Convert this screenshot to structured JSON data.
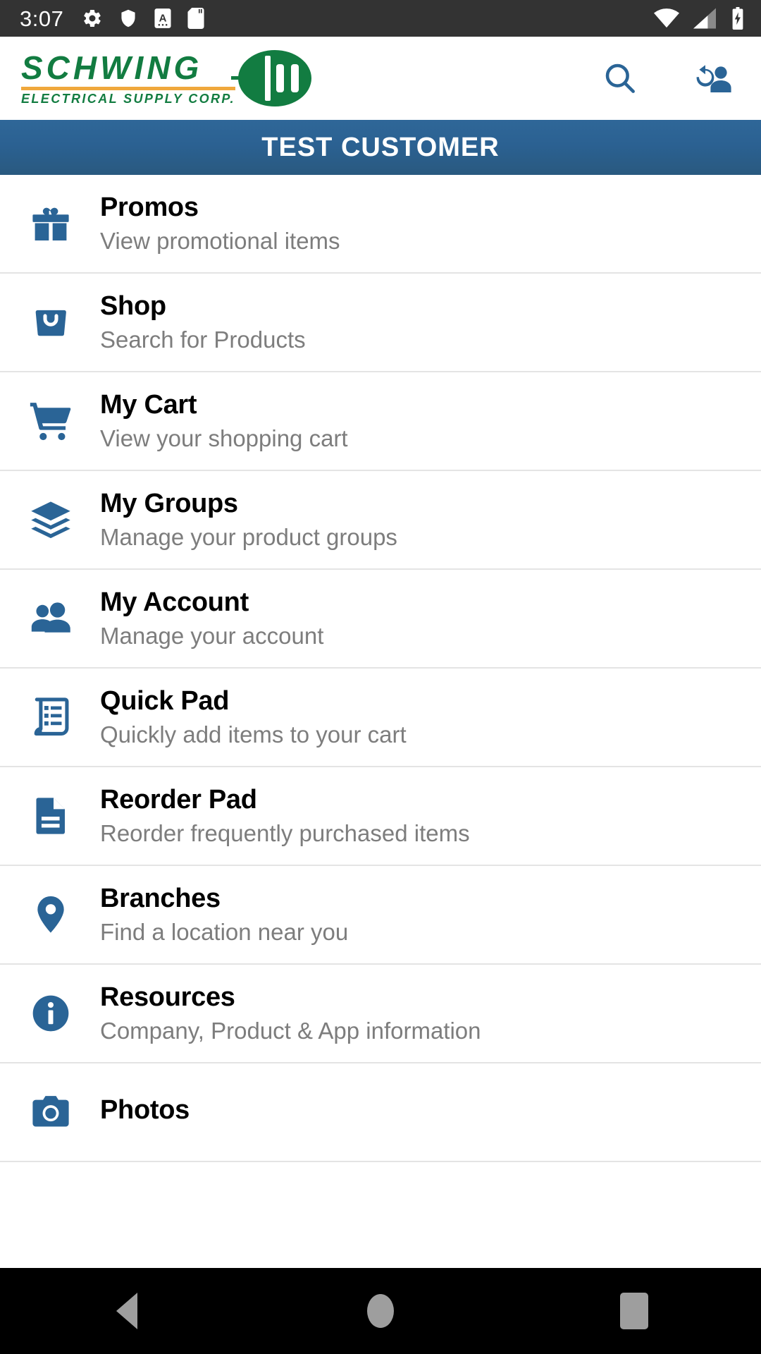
{
  "statusbar": {
    "time": "3:07",
    "left_icons": [
      "gear-icon",
      "shield-icon",
      "a-badge-icon",
      "sd-card-icon"
    ],
    "right_icons": [
      "wifi-icon",
      "cellular-signal-icon",
      "battery-charging-icon"
    ],
    "background_color": "#333333"
  },
  "header": {
    "logo_primary": "SCHWING",
    "logo_secondary": "ELECTRICAL SUPPLY CORP.",
    "logo_green": "#127c41",
    "logo_accent": "#f0a83c",
    "actions": [
      {
        "name": "search-button",
        "icon": "search-icon"
      },
      {
        "name": "switch-user-button",
        "icon": "switch-user-icon"
      }
    ],
    "action_color": "#2a6496"
  },
  "customer_banner": {
    "label": "TEST CUSTOMER",
    "background_color": "#2b6192",
    "text_color": "#ffffff"
  },
  "menu": {
    "icon_color": "#2a6496",
    "items": [
      {
        "icon": "gift-icon",
        "title": "Promos",
        "subtitle": "View promotional items"
      },
      {
        "icon": "shopping-bag-icon",
        "title": "Shop",
        "subtitle": "Search for Products"
      },
      {
        "icon": "shopping-cart-icon",
        "title": "My Cart",
        "subtitle": "View your shopping cart"
      },
      {
        "icon": "layers-icon",
        "title": "My Groups",
        "subtitle": "Manage your product groups"
      },
      {
        "icon": "people-icon",
        "title": "My Account",
        "subtitle": "Manage your account"
      },
      {
        "icon": "receipt-list-icon",
        "title": "Quick Pad",
        "subtitle": "Quickly add items to your cart"
      },
      {
        "icon": "document-icon",
        "title": "Reorder Pad",
        "subtitle": "Reorder frequently purchased items"
      },
      {
        "icon": "map-pin-icon",
        "title": "Branches",
        "subtitle": "Find a location near you"
      },
      {
        "icon": "info-circle-icon",
        "title": "Resources",
        "subtitle": "Company, Product & App information"
      },
      {
        "icon": "camera-icon",
        "title": "Photos",
        "subtitle": ""
      }
    ]
  },
  "navbar": {
    "buttons": [
      {
        "name": "nav-back-button",
        "icon": "triangle-left-icon"
      },
      {
        "name": "nav-home-button",
        "icon": "circle-icon"
      },
      {
        "name": "nav-recents-button",
        "icon": "square-icon"
      }
    ],
    "background_color": "#000000"
  }
}
